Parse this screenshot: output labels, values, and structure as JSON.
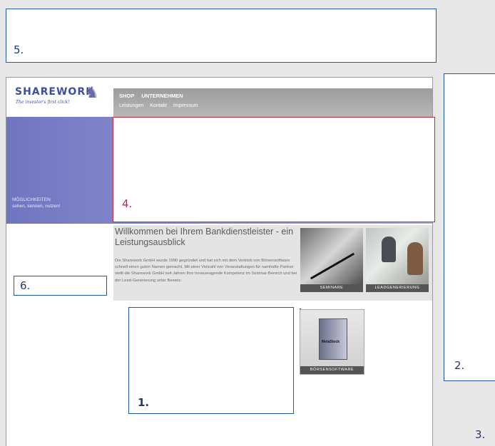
{
  "zones": {
    "z1": "1.",
    "z2": "2.",
    "z3": "3.",
    "z4": "4.",
    "z5": "5.",
    "z6": "6."
  },
  "logo": {
    "brand": "SHARЕWORK",
    "tagline": "The investor's first click!"
  },
  "nav": {
    "top": [
      "SHOP",
      "UNTERNEHMEN"
    ],
    "sub": [
      "Leistungen",
      "Kontakt",
      "Impressum"
    ]
  },
  "banner": {
    "slogan_line1": "MÖGLICHKEITEN",
    "slogan_line2": "sehen, kennen, nutzen!"
  },
  "intro": {
    "title": "Willkommen bei Ihrem Bankdienstleister - ein Leistungsausblick",
    "body": "Die Sharework GmbH wurde 1990 gegründet und hat sich mit dem Vertrieb von Börsensoftware schnell einen guten Namen gemacht. Mit einer Vielzahl von Veranstaltungen für namhafte Partner stellt die Sharework GmbH seit Jahren Ihre herausragende Kompetenz im Seminar-Bereich und bei der Lead-Generierung unter Beweis."
  },
  "tiles": {
    "seminare": "SEMINARE",
    "lead": "LEADGENERIERUNG",
    "software": "BÖRSENSOFTWARE",
    "software_box": "MetaStock"
  },
  "colors": {
    "zone_border": "#1f5aa8",
    "highlight_border": "#c0293a",
    "banner": "#8e92d2"
  }
}
